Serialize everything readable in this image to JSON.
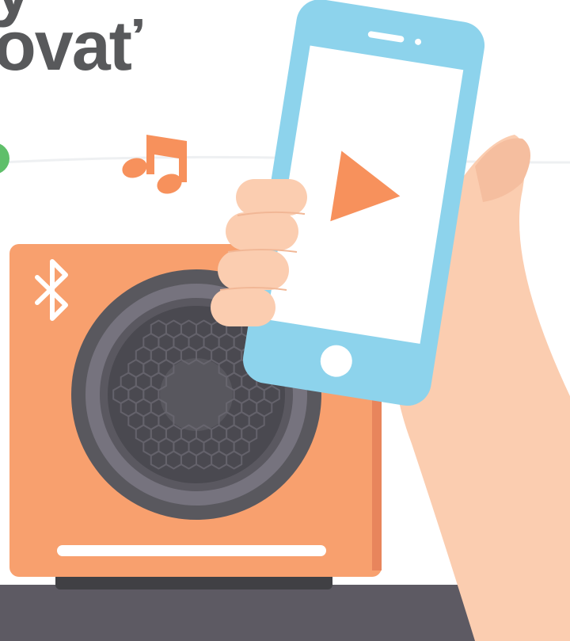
{
  "heading": {
    "line_top": "y",
    "line_bottom": "ovať"
  },
  "colors": {
    "speaker": "#f8a06e",
    "speaker_shade": "#e8855c",
    "phone": "#8dd3ec",
    "play": "#f7915c",
    "skin": "#fbcdb0",
    "floor": "#5d5a63",
    "text": "#58595b",
    "green_dot": "#5fbf6a"
  },
  "icons": {
    "speaker_logo": "bluetooth-icon",
    "phone_screen": "play-icon",
    "floating": "music-note-icon"
  }
}
